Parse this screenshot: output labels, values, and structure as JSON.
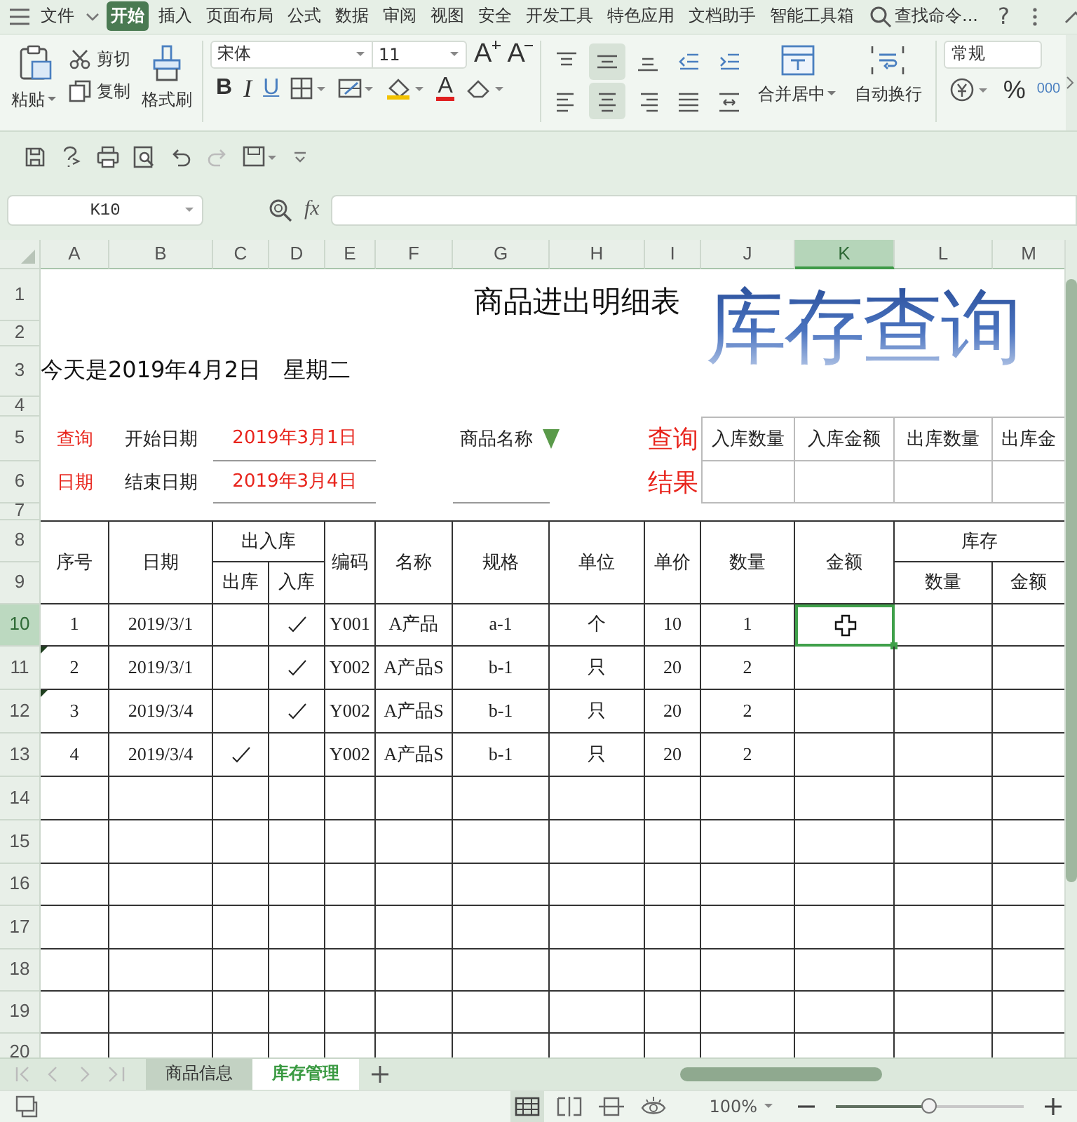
{
  "menu": {
    "items": [
      {
        "label": "文件",
        "selected": false
      },
      {
        "label": "开始",
        "selected": true
      },
      {
        "label": "插入",
        "selected": false
      },
      {
        "label": "页面布局",
        "selected": false
      },
      {
        "label": "公式",
        "selected": false
      },
      {
        "label": "数据",
        "selected": false
      },
      {
        "label": "审阅",
        "selected": false
      },
      {
        "label": "视图",
        "selected": false
      },
      {
        "label": "安全",
        "selected": false
      },
      {
        "label": "开发工具",
        "selected": false
      },
      {
        "label": "特色应用",
        "selected": false
      },
      {
        "label": "文档助手",
        "selected": false
      },
      {
        "label": "智能工具箱",
        "selected": false
      }
    ],
    "search": "查找命令...",
    "help": "?"
  },
  "ribbon": {
    "paste": "粘贴",
    "cut": "剪切",
    "copy": "复制",
    "format_painter": "格式刷",
    "font_name": "宋体",
    "font_size": "11",
    "size_buttons": [
      {
        "kind": "grow",
        "label": "A"
      },
      {
        "kind": "shrink",
        "label": "A"
      }
    ],
    "style_buttons": [
      {
        "kind": "bold",
        "label": "B"
      },
      {
        "kind": "italic",
        "label": "I"
      },
      {
        "kind": "underline",
        "label": "U"
      }
    ],
    "font_color": "A",
    "align": [
      {
        "kind": "top",
        "selected": false
      },
      {
        "kind": "middle",
        "selected": true
      },
      {
        "kind": "bottom",
        "selected": false
      },
      {
        "kind": "outdent",
        "selected": false
      },
      {
        "kind": "indent",
        "selected": false
      },
      {
        "kind": "left",
        "selected": false
      },
      {
        "kind": "center",
        "selected": true
      },
      {
        "kind": "right",
        "selected": false
      },
      {
        "kind": "justify",
        "selected": false
      },
      {
        "kind": "distributed",
        "selected": false
      }
    ],
    "merge": "合并居中",
    "wrap": "自动换行",
    "number_format": "常规",
    "percent": "%",
    "thousands": "000"
  },
  "formula_bar": {
    "name_box": "K10",
    "fx": "fx"
  },
  "columns": [
    {
      "label": "A",
      "selected": false
    },
    {
      "label": "B",
      "selected": false
    },
    {
      "label": "C",
      "selected": false
    },
    {
      "label": "D",
      "selected": false
    },
    {
      "label": "E",
      "selected": false
    },
    {
      "label": "F",
      "selected": false
    },
    {
      "label": "G",
      "selected": false
    },
    {
      "label": "H",
      "selected": false
    },
    {
      "label": "I",
      "selected": false
    },
    {
      "label": "J",
      "selected": false
    },
    {
      "label": "K",
      "selected": true
    },
    {
      "label": "L",
      "selected": false
    },
    {
      "label": "M",
      "selected": false
    }
  ],
  "rows": [
    {
      "label": "1",
      "selected": false
    },
    {
      "label": "2",
      "selected": false
    },
    {
      "label": "3",
      "selected": false
    },
    {
      "label": "4",
      "selected": false
    },
    {
      "label": "5",
      "selected": false
    },
    {
      "label": "6",
      "selected": false
    },
    {
      "label": "7",
      "selected": false
    },
    {
      "label": "8",
      "selected": false
    },
    {
      "label": "9",
      "selected": false
    },
    {
      "label": "10",
      "selected": true
    },
    {
      "label": "11",
      "selected": false
    },
    {
      "label": "12",
      "selected": false
    },
    {
      "label": "13",
      "selected": false
    },
    {
      "label": "14",
      "selected": false
    },
    {
      "label": "15",
      "selected": false
    },
    {
      "label": "16",
      "selected": false
    },
    {
      "label": "17",
      "selected": false
    },
    {
      "label": "18",
      "selected": false
    },
    {
      "label": "19",
      "selected": false
    },
    {
      "label": "20",
      "selected": false
    }
  ],
  "sheet": {
    "title": "商品进出明细表",
    "wordart": "库存查询",
    "today": "今天是2019年4月2日　星期二",
    "query": {
      "label_1": "查询",
      "label_2": "日期",
      "start_label": "开始日期",
      "start_value": "2019年3月1日",
      "end_label": "结束日期",
      "end_value": "2019年3月4日",
      "product_label": "商品名称",
      "result_label_1": "查询",
      "result_label_2": "结果",
      "result_headers": [
        "入库数量",
        "入库金额",
        "出库数量",
        "出库金"
      ]
    },
    "headers": {
      "no": "序号",
      "date": "日期",
      "inout": "出入库",
      "out": "出库",
      "in": "入库",
      "code": "编码",
      "name": "名称",
      "spec": "规格",
      "unit": "单位",
      "price": "单价",
      "qty": "数量",
      "amount": "金额",
      "stock": "库存",
      "stock_qty": "数量",
      "stock_amount": "金额"
    },
    "records": [
      {
        "no": "1",
        "date": "2019/3/1",
        "out_checked": false,
        "in_checked": true,
        "code": "Y001",
        "name": "A产品",
        "spec": "a-1",
        "unit": "个",
        "price": "10",
        "qty": "1",
        "error_marker": false
      },
      {
        "no": "2",
        "date": "2019/3/1",
        "out_checked": false,
        "in_checked": true,
        "code": "Y002",
        "name": "A产品S",
        "spec": "b-1",
        "unit": "只",
        "price": "20",
        "qty": "2",
        "error_marker": true
      },
      {
        "no": "3",
        "date": "2019/3/4",
        "out_checked": false,
        "in_checked": true,
        "code": "Y002",
        "name": "A产品S",
        "spec": "b-1",
        "unit": "只",
        "price": "20",
        "qty": "2",
        "error_marker": true
      },
      {
        "no": "4",
        "date": "2019/3/4",
        "out_checked": true,
        "in_checked": false,
        "code": "Y002",
        "name": "A产品S",
        "spec": "b-1",
        "unit": "只",
        "price": "20",
        "qty": "2",
        "error_marker": false
      }
    ]
  },
  "sheet_tabs": [
    {
      "label": "商品信息",
      "selected": false
    },
    {
      "label": "库存管理",
      "selected": true
    }
  ],
  "status_bar": {
    "views": [
      {
        "kind": "normal",
        "selected": true
      },
      {
        "kind": "page_break",
        "selected": false
      },
      {
        "kind": "layout",
        "selected": false
      },
      {
        "kind": "reading",
        "selected": false
      }
    ],
    "zoom": {
      "label": "100%",
      "level": 0.5
    }
  }
}
